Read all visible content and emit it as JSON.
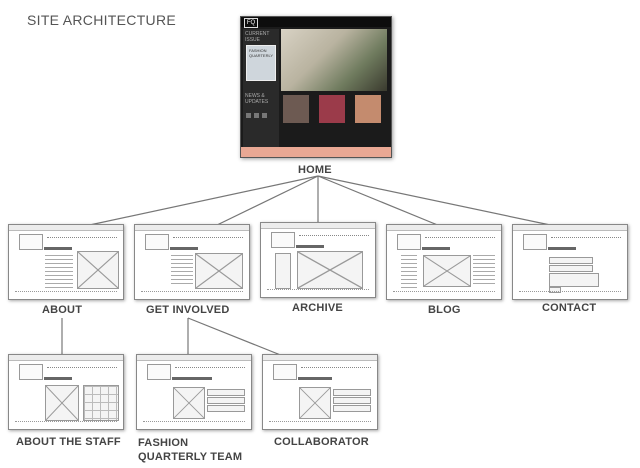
{
  "title": "SITE ARCHITECTURE",
  "nodes": {
    "home": "HOME",
    "about": "ABOUT",
    "get_involved": "GET INVOLVED",
    "archive": "ARCHIVE",
    "blog": "BLOG",
    "contact": "CONTACT",
    "about_staff": "ABOUT THE STAFF",
    "fq_team": "FASHION QUARTERLY TEAM",
    "collaborator": "COLLABORATOR"
  },
  "home_mockup": {
    "logo": "FQ",
    "current_issue": "CURRENT ISSUE",
    "news": "NEWS & UPDATES",
    "issue_cover": "FASHION QUARTERLY"
  },
  "colors": {
    "connector": "#777777",
    "home_footer": "#e9a894",
    "home_background": "#1b1b1b"
  }
}
